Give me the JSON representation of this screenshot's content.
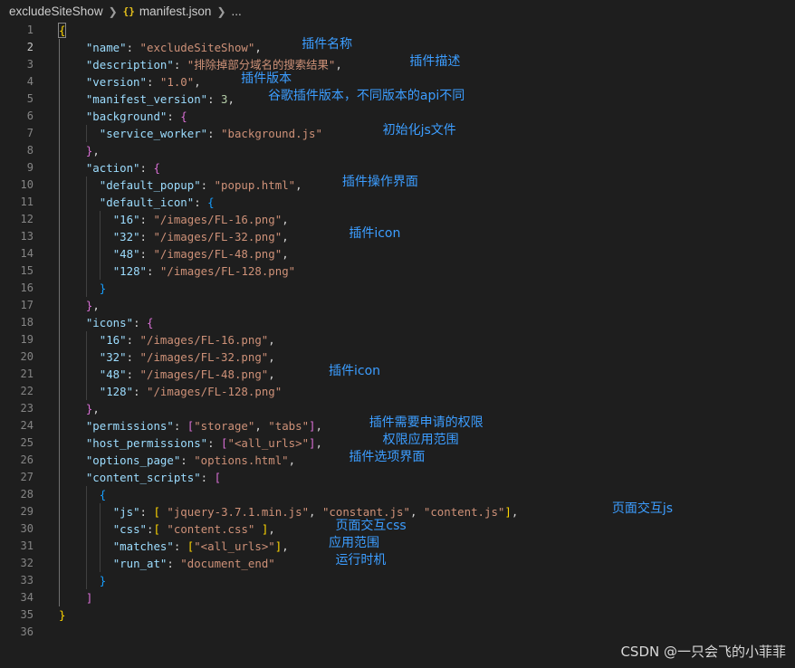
{
  "breadcrumb": {
    "folder": "excludeSiteShow",
    "file_icon": "{}",
    "file": "manifest.json",
    "more": "..."
  },
  "editor": {
    "active_line": 2,
    "line_numbers": [
      "1",
      "2",
      "3",
      "4",
      "5",
      "6",
      "7",
      "8",
      "9",
      "10",
      "11",
      "12",
      "13",
      "14",
      "15",
      "16",
      "17",
      "18",
      "19",
      "20",
      "21",
      "22",
      "23",
      "24",
      "25",
      "26",
      "27",
      "28",
      "29",
      "30",
      "31",
      "32",
      "33",
      "34",
      "35",
      "36"
    ],
    "lines": [
      [
        [
          "{",
          "b1"
        ]
      ],
      [
        [
          "    "
        ],
        [
          "\"name\"",
          "key"
        ],
        [
          ": "
        ],
        [
          "\"excludeSiteShow\"",
          "str"
        ],
        [
          ","
        ]
      ],
      [
        [
          "    "
        ],
        [
          "\"description\"",
          "key"
        ],
        [
          ": "
        ],
        [
          "\"排除掉部分域名的搜索结果\"",
          "str"
        ],
        [
          ","
        ]
      ],
      [
        [
          "    "
        ],
        [
          "\"version\"",
          "key"
        ],
        [
          ": "
        ],
        [
          "\"1.0\"",
          "str"
        ],
        [
          ","
        ]
      ],
      [
        [
          "    "
        ],
        [
          "\"manifest_version\"",
          "key"
        ],
        [
          ": "
        ],
        [
          "3",
          "num"
        ],
        [
          ","
        ]
      ],
      [
        [
          "    "
        ],
        [
          "\"background\"",
          "key"
        ],
        [
          ": "
        ],
        [
          "{",
          "b2"
        ]
      ],
      [
        [
          "      "
        ],
        [
          "\"service_worker\"",
          "key"
        ],
        [
          ": "
        ],
        [
          "\"background.js\"",
          "str"
        ]
      ],
      [
        [
          "    "
        ],
        [
          "}",
          "b2"
        ],
        [
          ","
        ]
      ],
      [
        [
          "    "
        ],
        [
          "\"action\"",
          "key"
        ],
        [
          ": "
        ],
        [
          "{",
          "b2"
        ]
      ],
      [
        [
          "      "
        ],
        [
          "\"default_popup\"",
          "key"
        ],
        [
          ": "
        ],
        [
          "\"popup.html\"",
          "str"
        ],
        [
          ","
        ]
      ],
      [
        [
          "      "
        ],
        [
          "\"default_icon\"",
          "key"
        ],
        [
          ": "
        ],
        [
          "{",
          "b3"
        ]
      ],
      [
        [
          "        "
        ],
        [
          "\"16\"",
          "key"
        ],
        [
          ": "
        ],
        [
          "\"/images/FL-16.png\"",
          "str"
        ],
        [
          ","
        ]
      ],
      [
        [
          "        "
        ],
        [
          "\"32\"",
          "key"
        ],
        [
          ": "
        ],
        [
          "\"/images/FL-32.png\"",
          "str"
        ],
        [
          ","
        ]
      ],
      [
        [
          "        "
        ],
        [
          "\"48\"",
          "key"
        ],
        [
          ": "
        ],
        [
          "\"/images/FL-48.png\"",
          "str"
        ],
        [
          ","
        ]
      ],
      [
        [
          "        "
        ],
        [
          "\"128\"",
          "key"
        ],
        [
          ": "
        ],
        [
          "\"/images/FL-128.png\"",
          "str"
        ]
      ],
      [
        [
          "      "
        ],
        [
          "}",
          "b3"
        ]
      ],
      [
        [
          "    "
        ],
        [
          "}",
          "b2"
        ],
        [
          ","
        ]
      ],
      [
        [
          "    "
        ],
        [
          "\"icons\"",
          "key"
        ],
        [
          ": "
        ],
        [
          "{",
          "b2"
        ]
      ],
      [
        [
          "      "
        ],
        [
          "\"16\"",
          "key"
        ],
        [
          ": "
        ],
        [
          "\"/images/FL-16.png\"",
          "str"
        ],
        [
          ","
        ]
      ],
      [
        [
          "      "
        ],
        [
          "\"32\"",
          "key"
        ],
        [
          ": "
        ],
        [
          "\"/images/FL-32.png\"",
          "str"
        ],
        [
          ","
        ]
      ],
      [
        [
          "      "
        ],
        [
          "\"48\"",
          "key"
        ],
        [
          ": "
        ],
        [
          "\"/images/FL-48.png\"",
          "str"
        ],
        [
          ","
        ]
      ],
      [
        [
          "      "
        ],
        [
          "\"128\"",
          "key"
        ],
        [
          ": "
        ],
        [
          "\"/images/FL-128.png\"",
          "str"
        ]
      ],
      [
        [
          "    "
        ],
        [
          "}",
          "b2"
        ],
        [
          ","
        ]
      ],
      [
        [
          "    "
        ],
        [
          "\"permissions\"",
          "key"
        ],
        [
          ": "
        ],
        [
          "[",
          "b2"
        ],
        [
          "\"storage\"",
          "str"
        ],
        [
          ", "
        ],
        [
          "\"tabs\"",
          "str"
        ],
        [
          "]",
          "b2"
        ],
        [
          ","
        ]
      ],
      [
        [
          "    "
        ],
        [
          "\"host_permissions\"",
          "key"
        ],
        [
          ": "
        ],
        [
          "[",
          "b2"
        ],
        [
          "\"<all_urls>\"",
          "str"
        ],
        [
          "]",
          "b2"
        ],
        [
          ","
        ]
      ],
      [
        [
          "    "
        ],
        [
          "\"options_page\"",
          "key"
        ],
        [
          ": "
        ],
        [
          "\"options.html\"",
          "str"
        ],
        [
          ","
        ]
      ],
      [
        [
          "    "
        ],
        [
          "\"content_scripts\"",
          "key"
        ],
        [
          ": "
        ],
        [
          "[",
          "b2"
        ]
      ],
      [
        [
          "      "
        ],
        [
          "{",
          "b3"
        ]
      ],
      [
        [
          "        "
        ],
        [
          "\"js\"",
          "key"
        ],
        [
          ": "
        ],
        [
          "[",
          "b1"
        ],
        [
          " "
        ],
        [
          "\"jquery-3.7.1.min.js\"",
          "str"
        ],
        [
          ", "
        ],
        [
          "\"constant.js\"",
          "str"
        ],
        [
          ", "
        ],
        [
          "\"content.js\"",
          "str"
        ],
        [
          "]",
          "b1"
        ],
        [
          ","
        ]
      ],
      [
        [
          "        "
        ],
        [
          "\"css\"",
          "key"
        ],
        [
          ":"
        ],
        [
          "[",
          "b1"
        ],
        [
          " "
        ],
        [
          "\"content.css\"",
          "str"
        ],
        [
          " "
        ],
        [
          "]",
          "b1"
        ],
        [
          ","
        ]
      ],
      [
        [
          "        "
        ],
        [
          "\"matches\"",
          "key"
        ],
        [
          ": "
        ],
        [
          "[",
          "b1"
        ],
        [
          "\"<all_urls>\"",
          "str"
        ],
        [
          "]",
          "b1"
        ],
        [
          ","
        ]
      ],
      [
        [
          "        "
        ],
        [
          "\"run_at\"",
          "key"
        ],
        [
          ": "
        ],
        [
          "\"document_end\"",
          "str"
        ]
      ],
      [
        [
          "      "
        ],
        [
          "}",
          "b3"
        ]
      ],
      [
        [
          "    "
        ],
        [
          "]",
          "b2"
        ]
      ],
      [
        [
          "}",
          "b1"
        ]
      ],
      [
        [
          ""
        ]
      ]
    ]
  },
  "annotations": [
    {
      "line": 2,
      "col": 36,
      "text": "插件名称"
    },
    {
      "line": 3,
      "col": 52,
      "text": "插件描述"
    },
    {
      "line": 4,
      "col": 27,
      "text": "插件版本"
    },
    {
      "line": 5,
      "col": 31,
      "text": "谷歌插件版本，不同版本的api不同"
    },
    {
      "line": 7,
      "col": 48,
      "text": "初始化js文件"
    },
    {
      "line": 10,
      "col": 42,
      "text": "插件操作界面"
    },
    {
      "line": 13,
      "col": 43,
      "text": "插件icon"
    },
    {
      "line": 21,
      "col": 40,
      "text": "插件icon"
    },
    {
      "line": 24,
      "col": 46,
      "text": "插件需要申请的权限"
    },
    {
      "line": 25,
      "col": 48,
      "text": "权限应用范围"
    },
    {
      "line": 26,
      "col": 43,
      "text": "插件选项界面"
    },
    {
      "line": 29,
      "col": 82,
      "text": "页面交互js"
    },
    {
      "line": 30,
      "col": 41,
      "text": "页面交互css"
    },
    {
      "line": 31,
      "col": 40,
      "text": "应用范围"
    },
    {
      "line": 32,
      "col": 41,
      "text": "运行时机"
    }
  ],
  "watermark": "CSDN @一只会飞的小菲菲"
}
